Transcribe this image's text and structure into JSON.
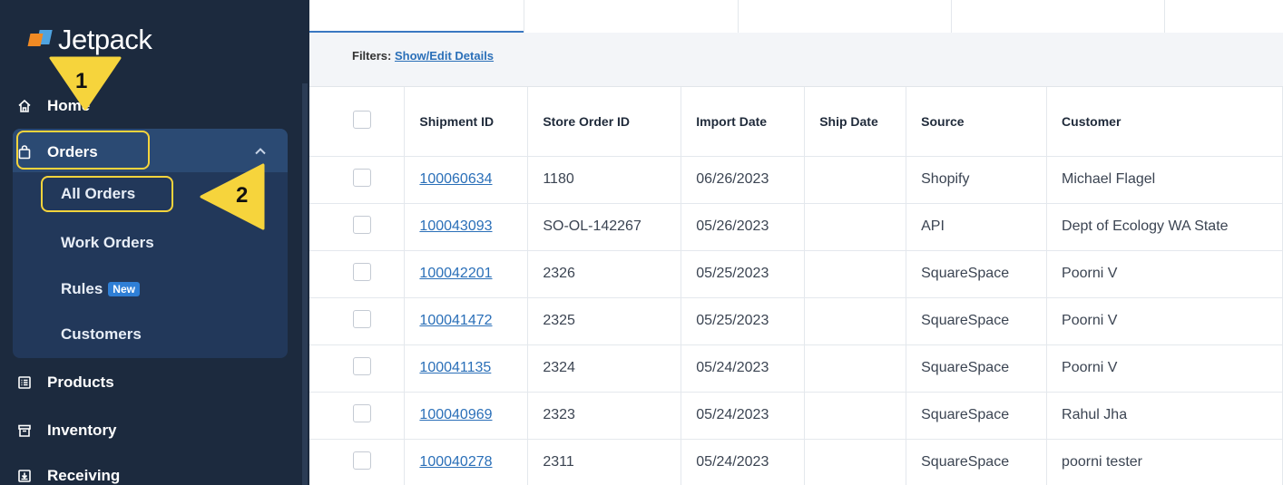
{
  "app": {
    "name": "Jetpack"
  },
  "sidebar": {
    "items": [
      {
        "key": "home",
        "label": "Home",
        "icon": "home-icon"
      },
      {
        "key": "orders",
        "label": "Orders",
        "icon": "shopping-bag-icon",
        "expanded": true
      },
      {
        "key": "products",
        "label": "Products",
        "icon": "list-box-icon"
      },
      {
        "key": "inventory",
        "label": "Inventory",
        "icon": "archive-box-icon"
      },
      {
        "key": "receiving",
        "label": "Receiving",
        "icon": "inbox-download-icon"
      }
    ],
    "orders_sub": [
      {
        "label": "All Orders",
        "active": true
      },
      {
        "label": "Work Orders"
      },
      {
        "label": "Rules",
        "badge": "New"
      },
      {
        "label": "Customers"
      }
    ]
  },
  "callouts": {
    "step1": "1",
    "step2": "2",
    "highlight_color": "#f6d43c"
  },
  "filters": {
    "label": "Filters:",
    "link": "Show/Edit Details"
  },
  "table": {
    "columns": [
      "Shipment ID",
      "Store Order ID",
      "Import Date",
      "Ship Date",
      "Source",
      "Customer"
    ],
    "rows": [
      [
        "100060634",
        "1180",
        "06/26/2023",
        "",
        "Shopify",
        "Michael Flagel"
      ],
      [
        "100043093",
        "SO-OL-142267",
        "05/26/2023",
        "",
        "API",
        "Dept of Ecology WA State"
      ],
      [
        "100042201",
        "2326",
        "05/25/2023",
        "",
        "SquareSpace",
        "Poorni V"
      ],
      [
        "100041472",
        "2325",
        "05/25/2023",
        "",
        "SquareSpace",
        "Poorni V"
      ],
      [
        "100041135",
        "2324",
        "05/24/2023",
        "",
        "SquareSpace",
        "Poorni V"
      ],
      [
        "100040969",
        "2323",
        "05/24/2023",
        "",
        "SquareSpace",
        "Rahul Jha"
      ],
      [
        "100040278",
        "2311",
        "05/24/2023",
        "",
        "SquareSpace",
        "poorni tester"
      ]
    ]
  },
  "colors": {
    "sidebar_bg": "#1c2a3e",
    "link": "#2a6fb8",
    "accent": "#2f7fd6"
  }
}
